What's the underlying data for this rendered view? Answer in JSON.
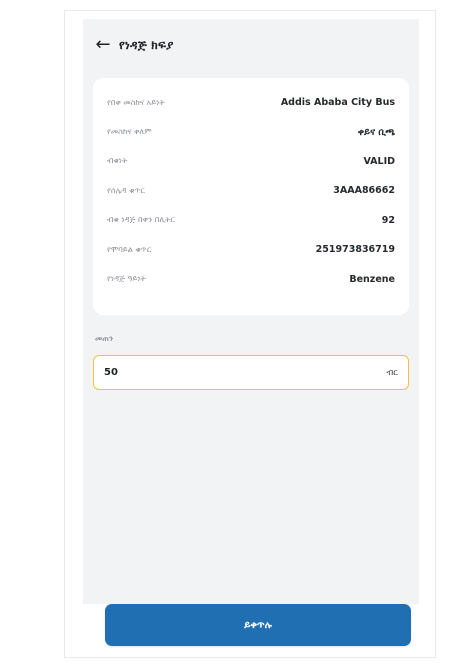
{
  "header": {
    "back_icon": "arrow-left-icon",
    "title": "የነዳጅ ክፍያ"
  },
  "details": [
    {
      "label": "የበቀ መስከና አይነት",
      "value": "Addis Ababa City Bus"
    },
    {
      "label": "የመስከና ቀለም",
      "value": "ቀይና ቢጫ"
    },
    {
      "label": "ብቁነት",
      "value": "VALID"
    },
    {
      "label": "የሰሌዳ ቁጥር",
      "value": "3AAA86662"
    },
    {
      "label": "ብቁ ነዳጅ በቀን በሊትር",
      "value": "92"
    },
    {
      "label": "የሞባይል ቁጥር",
      "value": "251973836719"
    },
    {
      "label": "የነዳጅ ዓይነት",
      "value": "Benzene"
    }
  ],
  "amount": {
    "label": "መጠን",
    "value": "50",
    "currency": "ብር"
  },
  "footer": {
    "button_label": "ይቀጥሉ"
  },
  "colors": {
    "accent": "#1f6fb2",
    "focus_border": "#f2c04b",
    "screen_bg": "#f2f3f5"
  }
}
